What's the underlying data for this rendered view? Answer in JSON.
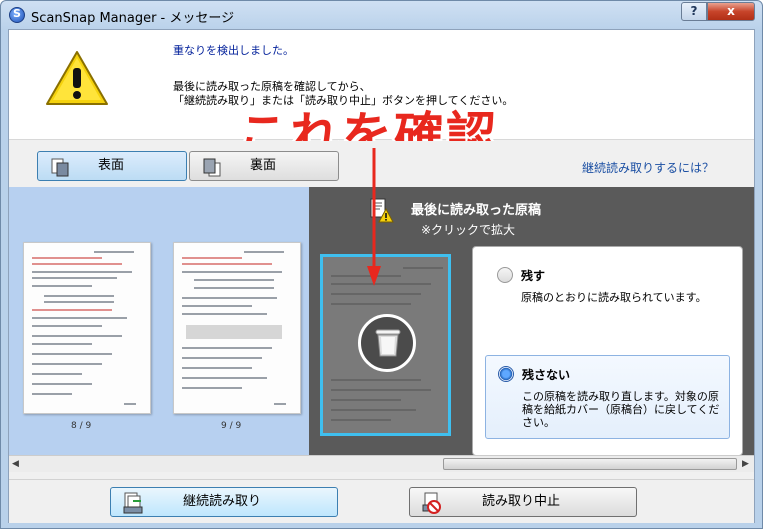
{
  "window": {
    "title": "ScanSnap Manager - メッセージ",
    "help_symbol": "?",
    "close_symbol": "x"
  },
  "message": {
    "title": "重なりを検出しました。",
    "line1": "最後に読み取った原稿を確認してから、",
    "line2": "「継続読み取り」または「読み取り中止」ボタンを押してください。"
  },
  "annotation": {
    "text": "これを確認",
    "color": "#e8281e"
  },
  "tabs": [
    {
      "label": "表面",
      "selected": true
    },
    {
      "label": "裏面",
      "selected": false
    }
  ],
  "help_link": "継続読み取りするには？",
  "thumbnails": [
    {
      "page": "8 / 9"
    },
    {
      "page": "9 / 9"
    }
  ],
  "last_scanned": {
    "title": "最後に読み取った原稿",
    "hint": "※クリックで拡大"
  },
  "options": [
    {
      "label": "残す",
      "description": "原稿のとおりに読み取られています。",
      "selected": false
    },
    {
      "label": "残さない",
      "description": "この原稿を読み取り直します。対象の原稿を給紙カバー（原稿台）に戻してください。",
      "selected": true
    }
  ],
  "buttons": {
    "continue": "継続読み取り",
    "stop": "読み取り中止"
  },
  "scrollbar": {
    "left_arrow": "◀",
    "right_arrow": "▶"
  },
  "colors": {
    "accent": "#3fbfef",
    "link": "#1b4fa3",
    "left_pane": "#b7d0f0",
    "dark_pane": "#5a5a5a"
  }
}
